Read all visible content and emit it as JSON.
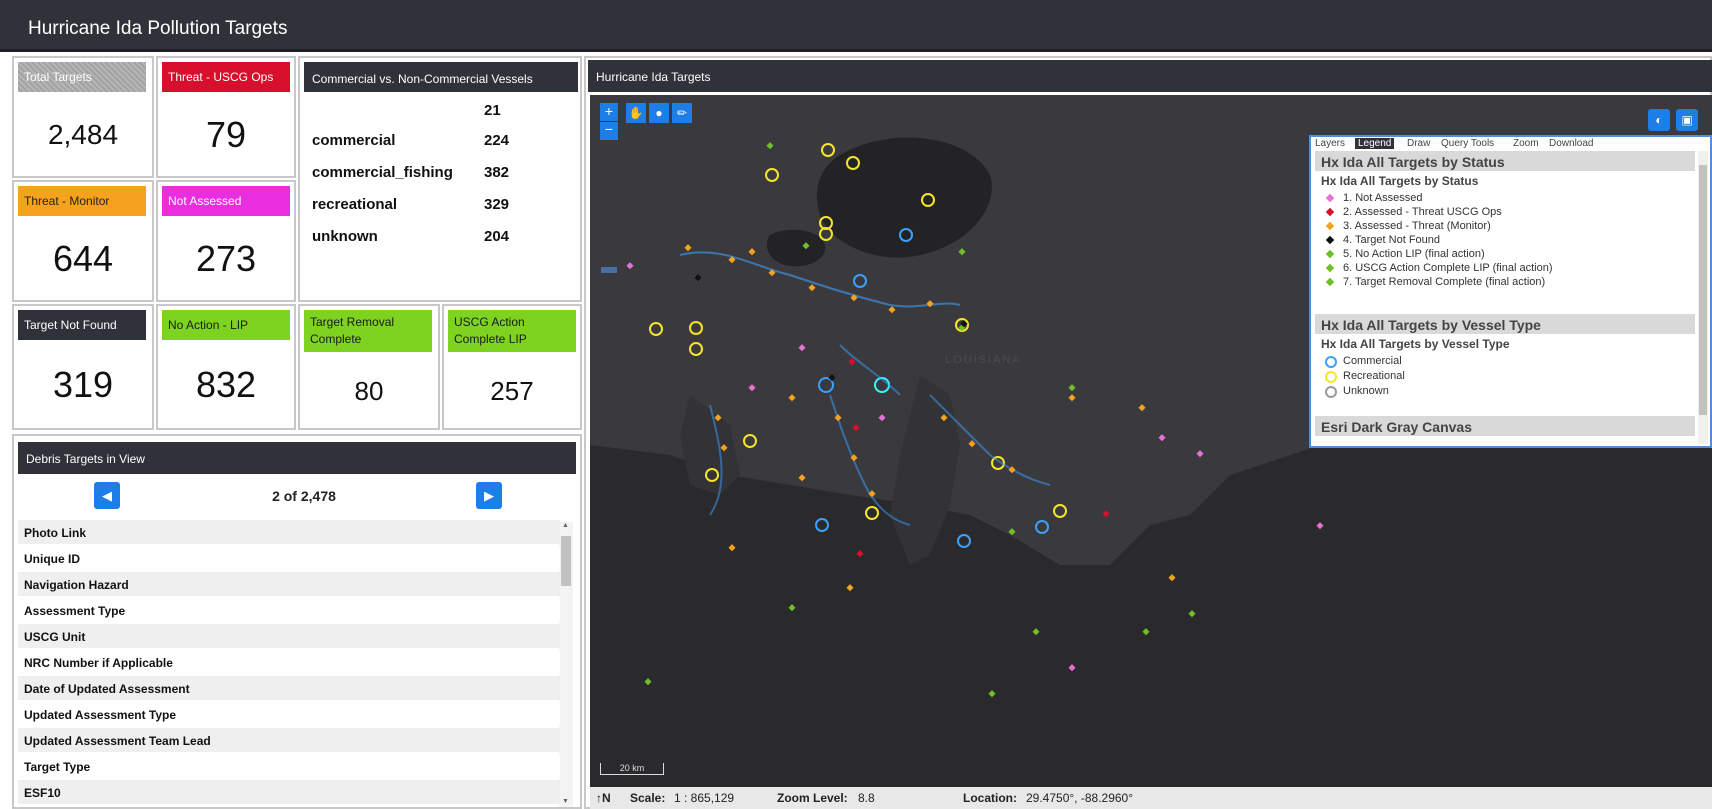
{
  "app": {
    "title": "Hurricane Ida Pollution Targets"
  },
  "tiles": [
    {
      "label": "Total Targets",
      "value": "2,484",
      "color": "#a9a9a9"
    },
    {
      "label": "Threat - USCG Ops",
      "value": "79",
      "color": "#d70f2c"
    },
    {
      "label": "Threat - Monitor",
      "value": "644",
      "color": "#f5a21e"
    },
    {
      "label": "Not Assessed",
      "value": "273",
      "color": "#e92ee0"
    },
    {
      "label": "Target Not Found",
      "value": "319",
      "color": "#2f3238"
    },
    {
      "label": "No Action - LIP",
      "value": "832",
      "color": "#7ed321"
    },
    {
      "label": "Target Removal Complete",
      "value": "80",
      "color": "#7ed321"
    },
    {
      "label": "USCG Action Complete LIP",
      "value": "257",
      "color": "#7ed321"
    }
  ],
  "vessels": {
    "title": "Commercial vs. Non-Commercial Vessels",
    "rows": [
      {
        "label": "",
        "count": "21"
      },
      {
        "label": "commercial",
        "count": "224"
      },
      {
        "label": "commercial_fishing",
        "count": "382"
      },
      {
        "label": "recreational",
        "count": "329"
      },
      {
        "label": "unknown",
        "count": "204"
      }
    ]
  },
  "debris": {
    "title": "Debris Targets in View",
    "pager": "2 of 2,478",
    "fields": [
      "Photo Link",
      "Unique ID",
      "Navigation Hazard",
      "Assessment Type",
      "USCG Unit",
      "NRC Number if Applicable",
      "Date of Updated Assessment",
      "Updated Assessment Type",
      "Updated Assessment Team Lead",
      "Target Type",
      "ESF10"
    ]
  },
  "map": {
    "title": "Hurricane Ida Targets",
    "scalebar": "20 km",
    "watermark": "LOUISIANA",
    "status": {
      "scale_label": "Scale:",
      "scale_value": "1 : 865,129",
      "zoom_label": "Zoom Level:",
      "zoom_value": "8.8",
      "location_label": "Location:",
      "location_value": "29.4750°, -88.2960°"
    }
  },
  "legend": {
    "tabs": [
      "Layers",
      "Legend",
      "Draw",
      "Query Tools",
      "Zoom",
      "Download"
    ],
    "active_tab": "Legend",
    "status_section": "Hx Ida All Targets by Status",
    "status_sub": "Hx Ida All Targets by Status",
    "status_items": [
      {
        "label": "1. Not Assessed",
        "color": "#e86fd6"
      },
      {
        "label": "2. Assessed - Threat USCG Ops",
        "color": "#d70f2c"
      },
      {
        "label": "3. Assessed - Threat (Monitor)",
        "color": "#f5a21e"
      },
      {
        "label": "4.  Target Not Found",
        "color": "#111111"
      },
      {
        "label": "5. No Action LIP (final action)",
        "color": "#6fbf2a"
      },
      {
        "label": "6. USCG Action Complete LIP (final action)",
        "color": "#6fbf2a"
      },
      {
        "label": "7. Target Removal Complete (final action)",
        "color": "#6fbf2a"
      }
    ],
    "type_section": "Hx Ida All Targets by Vessel Type",
    "type_sub": "Hx Ida All Targets by Vessel Type",
    "type_items": [
      {
        "label": "Commercial",
        "color": "#3aa0ff"
      },
      {
        "label": "Recreational",
        "color": "#f5e52a"
      },
      {
        "label": "Unknown",
        "color": "#9a9a9a"
      }
    ],
    "basemap_section": "Esri Dark Gray Canvas"
  }
}
